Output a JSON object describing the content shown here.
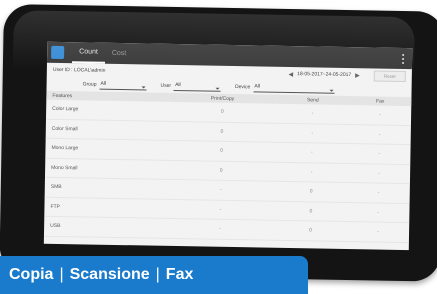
{
  "header": {
    "tabs": [
      {
        "label": "Count",
        "active": true
      },
      {
        "label": "Cost",
        "active": false
      }
    ],
    "menu_icon": "kebab-menu-icon"
  },
  "info": {
    "user_id": "User ID : LOCAL\\admin",
    "prev": "◀",
    "date_range": "18-05-2017~24-05-2017",
    "next": "▶",
    "reset_label": "Reset"
  },
  "filters": [
    {
      "label": "Group",
      "value": "All"
    },
    {
      "label": "User",
      "value": "All"
    },
    {
      "label": "Device",
      "value": "All"
    }
  ],
  "table": {
    "columns": [
      "Features",
      "Print/Copy",
      "Send",
      "Fax"
    ],
    "rows": [
      [
        "Color Large",
        "0",
        "-",
        "-"
      ],
      [
        "Color Small",
        "0",
        "-",
        "-"
      ],
      [
        "Mono Large",
        "0",
        "-",
        "-"
      ],
      [
        "Mono Small",
        "0",
        "-",
        "-"
      ],
      [
        "SMB",
        "-",
        "0",
        "-"
      ],
      [
        "FTP",
        "-",
        "0",
        "-"
      ],
      [
        "USB",
        "-",
        "0",
        "-"
      ]
    ]
  },
  "banner": {
    "items": [
      "Copia",
      "Scansione",
      "Fax"
    ],
    "separator": "|"
  },
  "colors": {
    "banner": "#1a7bcc",
    "topbar": "#3b3b3b",
    "accent": "#3a8ed6"
  }
}
